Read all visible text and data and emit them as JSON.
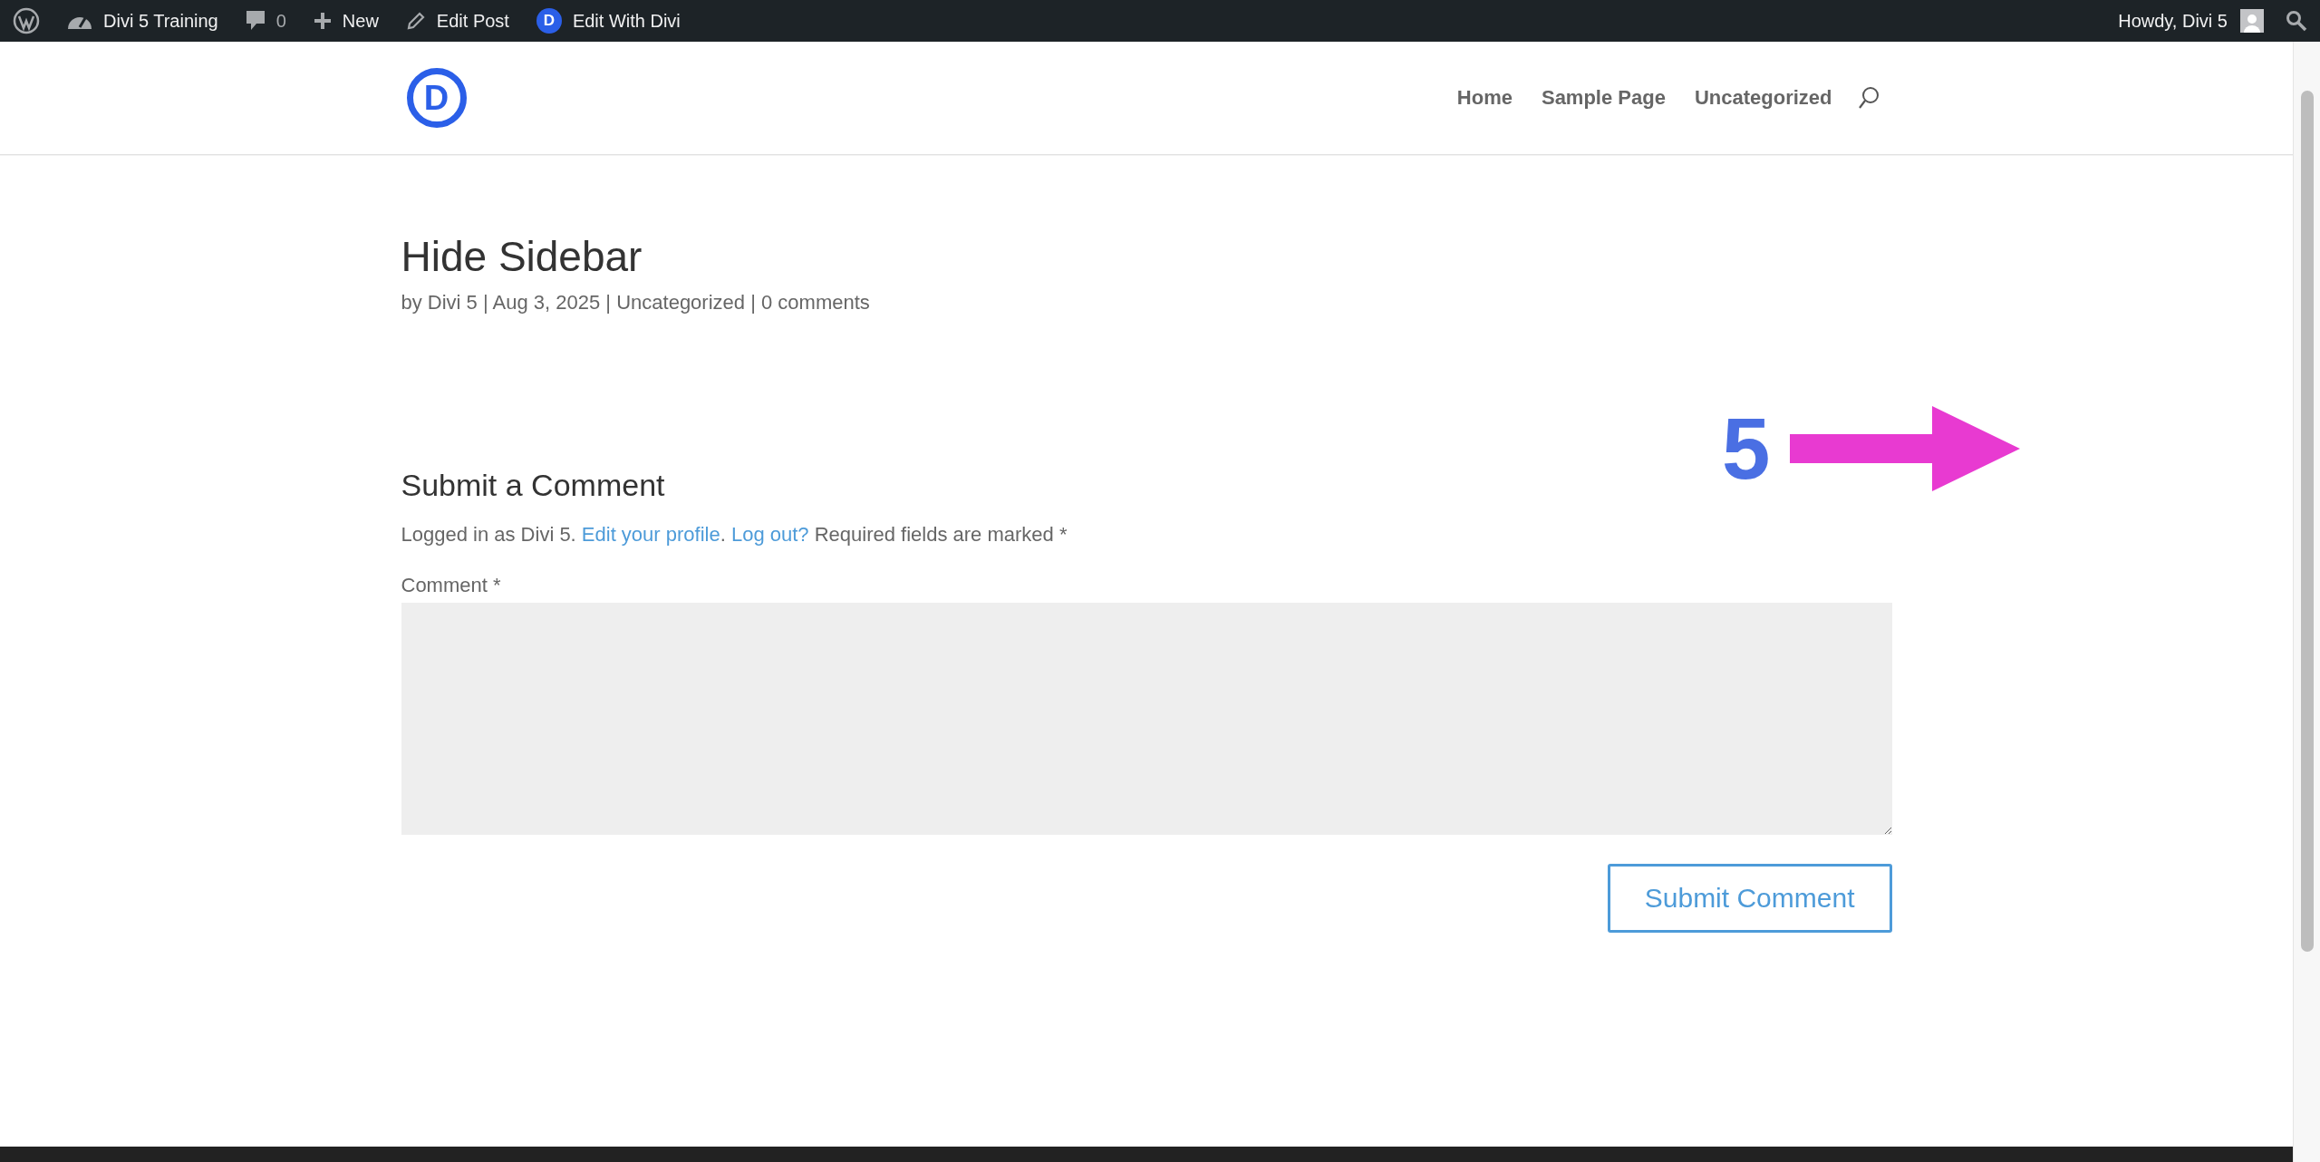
{
  "admin_bar": {
    "items": [
      {
        "kind": "wordpress"
      },
      {
        "kind": "site",
        "label": "Divi 5 Training"
      },
      {
        "kind": "comments",
        "label": "0"
      },
      {
        "kind": "new",
        "label": "New"
      },
      {
        "kind": "edit",
        "label": "Edit Post"
      },
      {
        "kind": "divi",
        "badge": "D",
        "label": "Edit With Divi"
      }
    ],
    "greeting": "Howdy, Divi 5"
  },
  "header": {
    "logo_letter": "D",
    "nav": [
      {
        "label": "Home"
      },
      {
        "label": "Sample Page"
      },
      {
        "label": "Uncategorized"
      }
    ]
  },
  "post": {
    "title": "Hide Sidebar",
    "meta": "by Divi 5 | Aug 3, 2025 | Uncategorized | 0 comments"
  },
  "comment_form": {
    "heading": "Submit a Comment",
    "notice": [
      {
        "kind": "text",
        "text": "Logged in as Divi 5. "
      },
      {
        "kind": "link",
        "text": "Edit your profile"
      },
      {
        "kind": "text",
        "text": ". "
      },
      {
        "kind": "link",
        "text": "Log out?"
      },
      {
        "kind": "text",
        "text": " Required fields are marked *"
      }
    ],
    "field_label": "Comment *",
    "button": "Submit Comment"
  },
  "annotation": {
    "number": "5"
  }
}
